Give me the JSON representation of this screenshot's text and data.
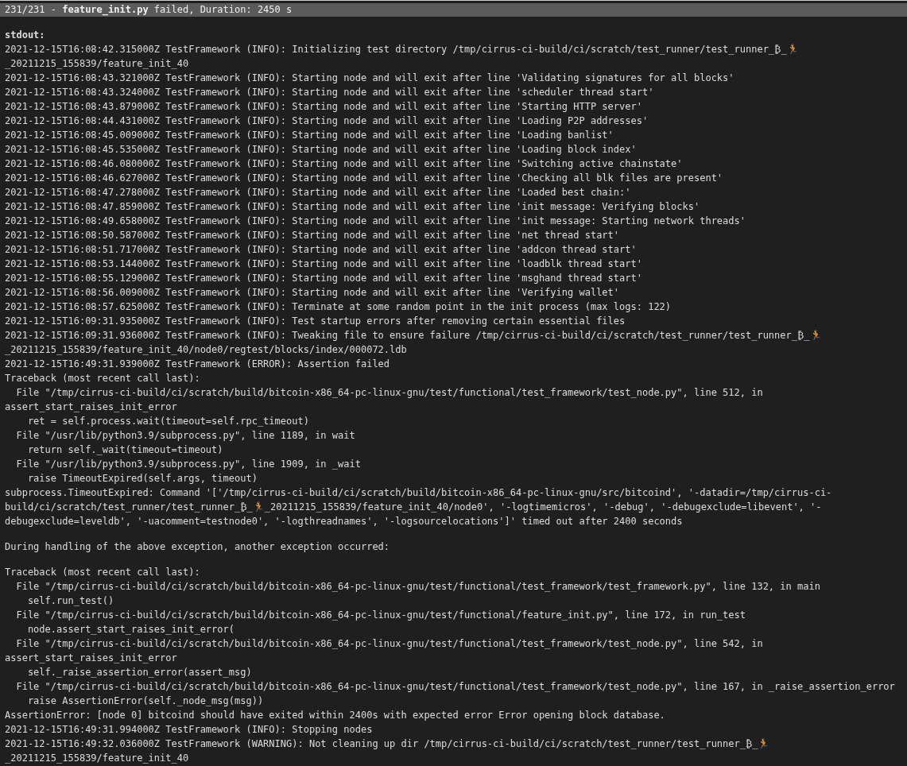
{
  "header": "231/231 - **feature_init.py** failed, Duration: 2450 s",
  "lines": [
    {
      "kind": "blank"
    },
    {
      "text": "stdout:",
      "kind": "heading"
    },
    {
      "text": "2021-12-15T16:08:42.315000Z TestFramework (INFO): Initializing test directory /tmp/cirrus-ci-build/ci/scratch/test_runner/test_runner_₿_🏃",
      "kind": "log"
    },
    {
      "text": "_20211215_155839/feature_init_40",
      "kind": "log"
    },
    {
      "text": "2021-12-15T16:08:43.321000Z TestFramework (INFO): Starting node and will exit after line 'Validating signatures for all blocks'",
      "kind": "log"
    },
    {
      "text": "2021-12-15T16:08:43.324000Z TestFramework (INFO): Starting node and will exit after line 'scheduler thread start'",
      "kind": "log"
    },
    {
      "text": "2021-12-15T16:08:43.879000Z TestFramework (INFO): Starting node and will exit after line 'Starting HTTP server'",
      "kind": "log"
    },
    {
      "text": "2021-12-15T16:08:44.431000Z TestFramework (INFO): Starting node and will exit after line 'Loading P2P addresses'",
      "kind": "log"
    },
    {
      "text": "2021-12-15T16:08:45.009000Z TestFramework (INFO): Starting node and will exit after line 'Loading banlist'",
      "kind": "log"
    },
    {
      "text": "2021-12-15T16:08:45.535000Z TestFramework (INFO): Starting node and will exit after line 'Loading block index'",
      "kind": "log"
    },
    {
      "text": "2021-12-15T16:08:46.080000Z TestFramework (INFO): Starting node and will exit after line 'Switching active chainstate'",
      "kind": "log"
    },
    {
      "text": "2021-12-15T16:08:46.627000Z TestFramework (INFO): Starting node and will exit after line 'Checking all blk files are present'",
      "kind": "log"
    },
    {
      "text": "2021-12-15T16:08:47.278000Z TestFramework (INFO): Starting node and will exit after line 'Loaded best chain:'",
      "kind": "log"
    },
    {
      "text": "2021-12-15T16:08:47.859000Z TestFramework (INFO): Starting node and will exit after line 'init message: Verifying blocks'",
      "kind": "log"
    },
    {
      "text": "2021-12-15T16:08:49.658000Z TestFramework (INFO): Starting node and will exit after line 'init message: Starting network threads'",
      "kind": "log"
    },
    {
      "text": "2021-12-15T16:08:50.587000Z TestFramework (INFO): Starting node and will exit after line 'net thread start'",
      "kind": "log"
    },
    {
      "text": "2021-12-15T16:08:51.717000Z TestFramework (INFO): Starting node and will exit after line 'addcon thread start'",
      "kind": "log"
    },
    {
      "text": "2021-12-15T16:08:53.144000Z TestFramework (INFO): Starting node and will exit after line 'loadblk thread start'",
      "kind": "log"
    },
    {
      "text": "2021-12-15T16:08:55.129000Z TestFramework (INFO): Starting node and will exit after line 'msghand thread start'",
      "kind": "log"
    },
    {
      "text": "2021-12-15T16:08:56.009000Z TestFramework (INFO): Starting node and will exit after line 'Verifying wallet'",
      "kind": "log"
    },
    {
      "text": "2021-12-15T16:08:57.625000Z TestFramework (INFO): Terminate at some random point in the init process (max logs: 122)",
      "kind": "log"
    },
    {
      "text": "2021-12-15T16:09:31.935000Z TestFramework (INFO): Test startup errors after removing certain essential files",
      "kind": "log"
    },
    {
      "text": "2021-12-15T16:09:31.936000Z TestFramework (INFO): Tweaking file to ensure failure /tmp/cirrus-ci-build/ci/scratch/test_runner/test_runner_₿_🏃",
      "kind": "log"
    },
    {
      "text": "_20211215_155839/feature_init_40/node0/regtest/blocks/index/000072.ldb",
      "kind": "log"
    },
    {
      "text": "2021-12-15T16:49:31.939000Z TestFramework (ERROR): Assertion failed",
      "kind": "log"
    },
    {
      "text": "Traceback (most recent call last):",
      "kind": "log"
    },
    {
      "text": "  File \"/tmp/cirrus-ci-build/ci/scratch/build/bitcoin-x86_64-pc-linux-gnu/test/functional/test_framework/test_node.py\", line 512, in",
      "kind": "log"
    },
    {
      "text": "assert_start_raises_init_error",
      "kind": "log"
    },
    {
      "text": "    ret = self.process.wait(timeout=self.rpc_timeout)",
      "kind": "log"
    },
    {
      "text": "  File \"/usr/lib/python3.9/subprocess.py\", line 1189, in wait",
      "kind": "log"
    },
    {
      "text": "    return self._wait(timeout=timeout)",
      "kind": "log"
    },
    {
      "text": "  File \"/usr/lib/python3.9/subprocess.py\", line 1909, in _wait",
      "kind": "log"
    },
    {
      "text": "    raise TimeoutExpired(self.args, timeout)",
      "kind": "log"
    },
    {
      "text": "subprocess.TimeoutExpired: Command '['/tmp/cirrus-ci-build/ci/scratch/build/bitcoin-x86_64-pc-linux-gnu/src/bitcoind', '-datadir=/tmp/cirrus-ci-",
      "kind": "log"
    },
    {
      "text": "build/ci/scratch/test_runner/test_runner_₿_🏃_20211215_155839/feature_init_40/node0', '-logtimemicros', '-debug', '-debugexclude=libevent', '-",
      "kind": "log"
    },
    {
      "text": "debugexclude=leveldb', '-uacomment=testnode0', '-logthreadnames', '-logsourcelocations']' timed out after 2400 seconds",
      "kind": "log"
    },
    {
      "kind": "blank"
    },
    {
      "text": "During handling of the above exception, another exception occurred:",
      "kind": "log"
    },
    {
      "kind": "blank"
    },
    {
      "text": "Traceback (most recent call last):",
      "kind": "log"
    },
    {
      "text": "  File \"/tmp/cirrus-ci-build/ci/scratch/build/bitcoin-x86_64-pc-linux-gnu/test/functional/test_framework/test_framework.py\", line 132, in main",
      "kind": "log"
    },
    {
      "text": "    self.run_test()",
      "kind": "log"
    },
    {
      "text": "  File \"/tmp/cirrus-ci-build/ci/scratch/build/bitcoin-x86_64-pc-linux-gnu/test/functional/feature_init.py\", line 172, in run_test",
      "kind": "log"
    },
    {
      "text": "    node.assert_start_raises_init_error(",
      "kind": "log"
    },
    {
      "text": "  File \"/tmp/cirrus-ci-build/ci/scratch/build/bitcoin-x86_64-pc-linux-gnu/test/functional/test_framework/test_node.py\", line 542, in",
      "kind": "log"
    },
    {
      "text": "assert_start_raises_init_error",
      "kind": "log"
    },
    {
      "text": "    self._raise_assertion_error(assert_msg)",
      "kind": "log"
    },
    {
      "text": "  File \"/tmp/cirrus-ci-build/ci/scratch/build/bitcoin-x86_64-pc-linux-gnu/test/functional/test_framework/test_node.py\", line 167, in _raise_assertion_error",
      "kind": "log"
    },
    {
      "text": "    raise AssertionError(self._node_msg(msg))",
      "kind": "log"
    },
    {
      "text": "AssertionError: [node 0] bitcoind should have exited within 2400s with expected error Error opening block database.",
      "kind": "log"
    },
    {
      "text": "2021-12-15T16:49:31.994000Z TestFramework (INFO): Stopping nodes",
      "kind": "log"
    },
    {
      "text": "2021-12-15T16:49:32.036000Z TestFramework (WARNING): Not cleaning up dir /tmp/cirrus-ci-build/ci/scratch/test_runner/test_runner_₿_🏃",
      "kind": "log"
    },
    {
      "text": "_20211215_155839/feature_init_40",
      "kind": "log"
    }
  ]
}
